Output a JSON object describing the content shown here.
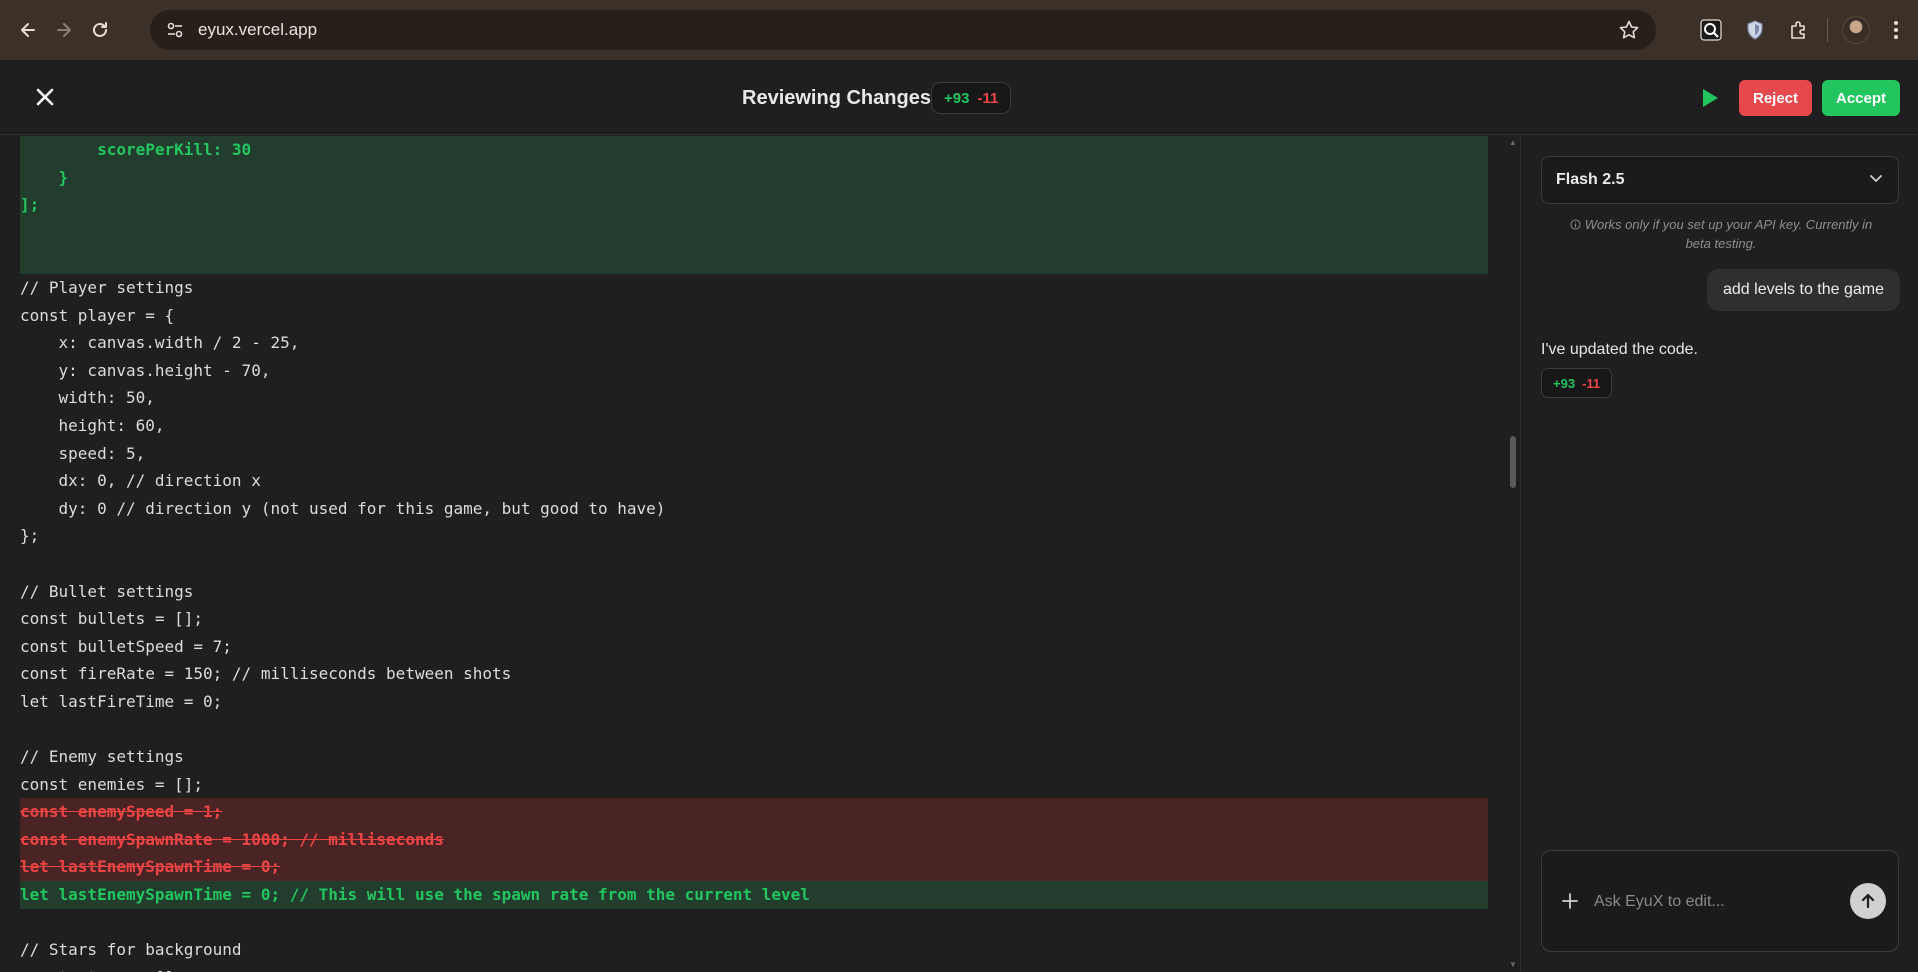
{
  "browser": {
    "url": "eyux.vercel.app",
    "icons": [
      "back-icon",
      "forward-icon",
      "reload-icon",
      "site-settings-icon",
      "bookmark-star-icon",
      "search-extension-icon",
      "shield-extension-icon",
      "extensions-puzzle-icon",
      "profile-avatar",
      "more-menu-icon"
    ]
  },
  "header": {
    "title": "Reviewing Changes",
    "additions": "+93",
    "deletions": "-11",
    "reject_label": "Reject",
    "accept_label": "Accept"
  },
  "code": {
    "lines": [
      {
        "type": "added",
        "text": "        scorePerKill: 30"
      },
      {
        "type": "added",
        "text": "    }"
      },
      {
        "type": "added",
        "text": "];"
      },
      {
        "type": "added",
        "text": ""
      },
      {
        "type": "added",
        "text": ""
      },
      {
        "type": "context",
        "text": "// Player settings"
      },
      {
        "type": "context",
        "text": "const player = {"
      },
      {
        "type": "context",
        "text": "    x: canvas.width / 2 - 25,"
      },
      {
        "type": "context",
        "text": "    y: canvas.height - 70,"
      },
      {
        "type": "context",
        "text": "    width: 50,"
      },
      {
        "type": "context",
        "text": "    height: 60,"
      },
      {
        "type": "context",
        "text": "    speed: 5,"
      },
      {
        "type": "context",
        "text": "    dx: 0, // direction x"
      },
      {
        "type": "context",
        "text": "    dy: 0 // direction y (not used for this game, but good to have)"
      },
      {
        "type": "context",
        "text": "};"
      },
      {
        "type": "context",
        "text": ""
      },
      {
        "type": "context",
        "text": "// Bullet settings"
      },
      {
        "type": "context",
        "text": "const bullets = [];"
      },
      {
        "type": "context",
        "text": "const bulletSpeed = 7;"
      },
      {
        "type": "context",
        "text": "const fireRate = 150; // milliseconds between shots"
      },
      {
        "type": "context",
        "text": "let lastFireTime = 0;"
      },
      {
        "type": "context",
        "text": ""
      },
      {
        "type": "context",
        "text": "// Enemy settings"
      },
      {
        "type": "context",
        "text": "const enemies = [];"
      },
      {
        "type": "removed",
        "text": "const enemySpeed = 1;"
      },
      {
        "type": "removed",
        "text": "const enemySpawnRate = 1000; // milliseconds"
      },
      {
        "type": "removed",
        "text": "let lastEnemySpawnTime = 0;"
      },
      {
        "type": "added",
        "text": "let lastEnemySpawnTime = 0; // This will use the spawn rate from the current level"
      },
      {
        "type": "context",
        "text": ""
      },
      {
        "type": "context",
        "text": "// Stars for background"
      },
      {
        "type": "context",
        "text": "const stars = [];"
      }
    ]
  },
  "side": {
    "model": "Flash 2.5",
    "api_note": "Works only if you set up your API key. Currently in beta testing.",
    "user_message": "add levels to the game",
    "bot_message": "I've updated the code.",
    "bot_additions": "+93",
    "bot_deletions": "-11",
    "input_placeholder": "Ask EyuX to edit..."
  }
}
